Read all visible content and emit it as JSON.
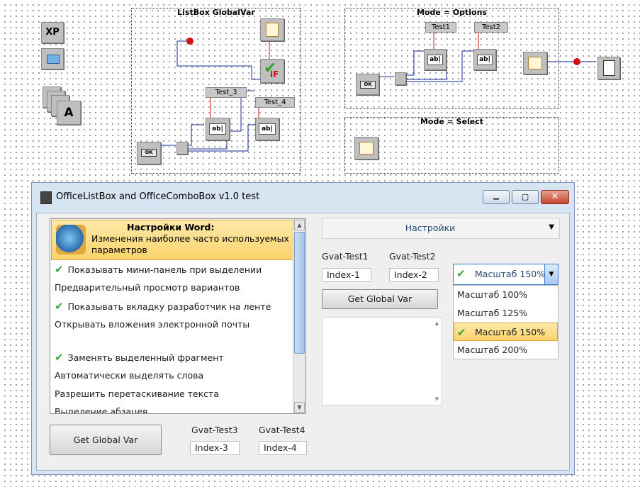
{
  "diagram": {
    "frame_listbox_title": "ListBox GlobalVar",
    "frame_options_title": "Mode = Options",
    "frame_select_title": "Mode = Select",
    "tag_test3": "Test_3",
    "tag_test4": "Test_4",
    "tag_test1": "Test1",
    "tag_test2": "Test2",
    "ok_label": "OK",
    "xp_label": "XP",
    "a_label": "A",
    "edit_label": "ab|",
    "if_label": "iF"
  },
  "window": {
    "title": "OfficeListBox and OfficeComboBox v1.0 test",
    "minimize_symbol": "▁",
    "maximize_symbol": "▢",
    "close_symbol": "✕"
  },
  "listbox": {
    "header_title": "Настройки Word:",
    "header_desc_line1": "Изменения наиболее часто используемых",
    "header_desc_line2": "параметров",
    "items": [
      {
        "label": "Показывать мини-панель при выделении",
        "checked": true
      },
      {
        "label": "Предварительный просмотр вариантов",
        "checked": false
      },
      {
        "label": "Показывать вкладку разработчик на ленте",
        "checked": true
      },
      {
        "label": "Открывать вложения электронной почты",
        "checked": false
      },
      {
        "label": "Заменять выделенный фрагмент",
        "checked": true
      },
      {
        "label": "Автоматически выделять слова",
        "checked": false
      },
      {
        "label": "Разрешить перетаскивание текста",
        "checked": false
      },
      {
        "label": "Выделение абзацев",
        "checked": false
      }
    ]
  },
  "bottom_left": {
    "button_label": "Get Global Var",
    "label3": "Gvat-Test3",
    "label4": "Gvat-Test4",
    "value3": "Index-3",
    "value4": "Index-4"
  },
  "right_panel": {
    "combo_top_label": "Настройки",
    "label1": "Gvat-Test1",
    "label2": "Gvat-Test2",
    "value1": "Index-1",
    "value2": "Index-2",
    "button_label": "Get Global Var"
  },
  "zoom_combo": {
    "selected": "Масштаб 150%",
    "options": [
      "Масштаб 100%",
      "Масштаб 125%",
      "Масштаб 150%",
      "Масштаб 200%"
    ]
  },
  "colors": {
    "highlight": "#fbd36d",
    "check": "#3aa53a",
    "wire_blue": "#1a2a9a",
    "wire_red": "#d01010"
  }
}
